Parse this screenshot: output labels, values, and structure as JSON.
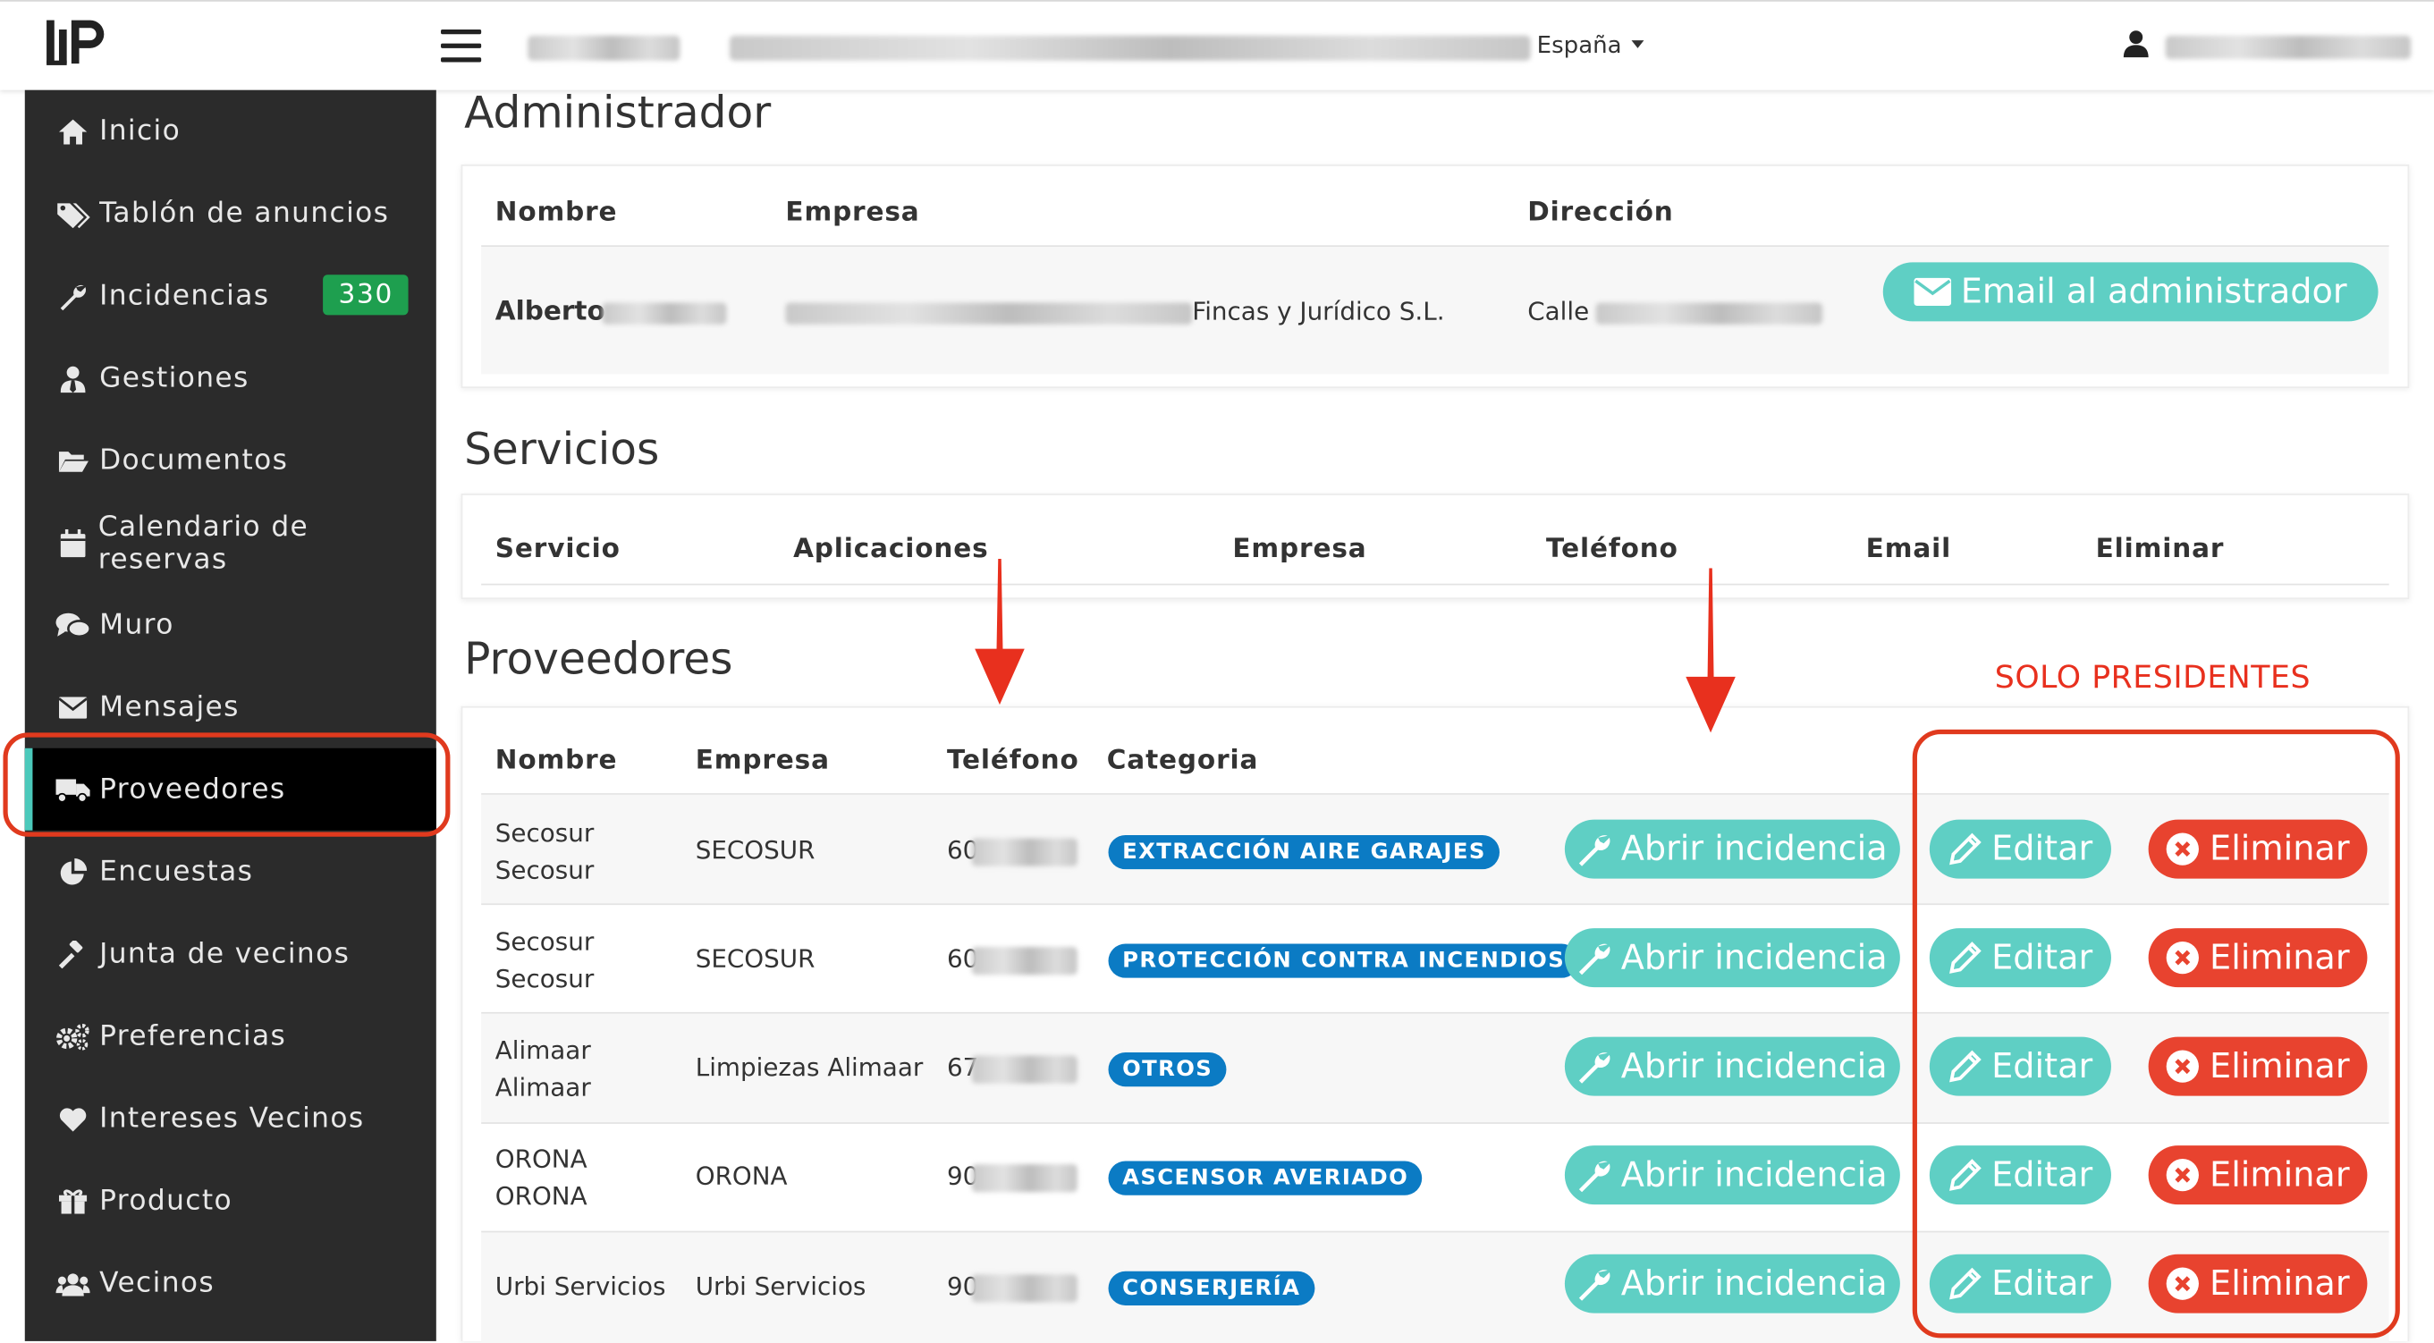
{
  "header": {
    "country": "España"
  },
  "sidebar": {
    "items": [
      {
        "label": "Inicio",
        "icon": "home-icon"
      },
      {
        "label": "Tablón de anuncios",
        "icon": "tags-icon"
      },
      {
        "label": "Incidencias",
        "icon": "wrench-icon",
        "badge": "330"
      },
      {
        "label": "Gestiones",
        "icon": "user-tie-icon"
      },
      {
        "label": "Documentos",
        "icon": "folder-open-icon"
      },
      {
        "label": "Calendario de reservas",
        "icon": "calendar-icon"
      },
      {
        "label": "Muro",
        "icon": "comments-icon"
      },
      {
        "label": "Mensajes",
        "icon": "envelope-icon"
      },
      {
        "label": "Proveedores",
        "icon": "truck-icon",
        "active": true
      },
      {
        "label": "Encuestas",
        "icon": "pie-chart-icon"
      },
      {
        "label": "Junta de vecinos",
        "icon": "gavel-icon"
      },
      {
        "label": "Preferencias",
        "icon": "cogs-icon"
      },
      {
        "label": "Intereses Vecinos",
        "icon": "heart-icon"
      },
      {
        "label": "Producto",
        "icon": "gift-icon"
      },
      {
        "label": "Vecinos",
        "icon": "users-icon"
      }
    ]
  },
  "admin": {
    "title": "Administrador",
    "headers": {
      "nombre": "Nombre",
      "empresa": "Empresa",
      "direccion": "Dirección"
    },
    "row": {
      "nombre": "Alberto",
      "empresa_suffix": "Fincas y Jurídico S.L.",
      "direccion": "Calle"
    },
    "email_button": "Email al administrador"
  },
  "servicios": {
    "title": "Servicios",
    "headers": [
      "Servicio",
      "Aplicaciones",
      "Empresa",
      "Teléfono",
      "Email",
      "Eliminar"
    ]
  },
  "proveedores": {
    "title": "Proveedores",
    "headers": {
      "nombre": "Nombre",
      "empresa": "Empresa",
      "telefono": "Teléfono",
      "categoria": "Categoria"
    },
    "rows": [
      {
        "nombre1": "Secosur",
        "nombre2": "Secosur",
        "empresa": "SECOSUR",
        "tel": "60",
        "categoria": "EXTRACCIÓN AIRE GARAJES"
      },
      {
        "nombre1": "Secosur",
        "nombre2": "Secosur",
        "empresa": "SECOSUR",
        "tel": "60",
        "categoria": "PROTECCIÓN CONTRA INCENDIOS"
      },
      {
        "nombre1": "Alimaar",
        "nombre2": "Alimaar",
        "empresa": "Limpiezas Alimaar",
        "tel": "67",
        "categoria": "OTROS"
      },
      {
        "nombre1": "ORONA",
        "nombre2": "ORONA",
        "empresa": "ORONA",
        "tel": "90",
        "categoria": "ASCENSOR AVERIADO"
      },
      {
        "nombre1": "Urbi Servicios",
        "nombre2": "",
        "empresa": "Urbi Servicios",
        "tel": "90",
        "categoria": "CONSERJERÍA"
      }
    ],
    "actions": {
      "abrir": "Abrir incidencia",
      "editar": "Editar",
      "eliminar": "Eliminar"
    }
  },
  "annotation": {
    "solo_presidentes": "SOLO PRESIDENTES"
  },
  "colors": {
    "accent_teal": "#5fcfc4",
    "danger_red": "#e8432f",
    "tag_blue": "#0b7bc4",
    "badge_green": "#1e9f4f",
    "annotation_red": "#e03a1e",
    "sidebar_bg": "#2b2b2b"
  }
}
